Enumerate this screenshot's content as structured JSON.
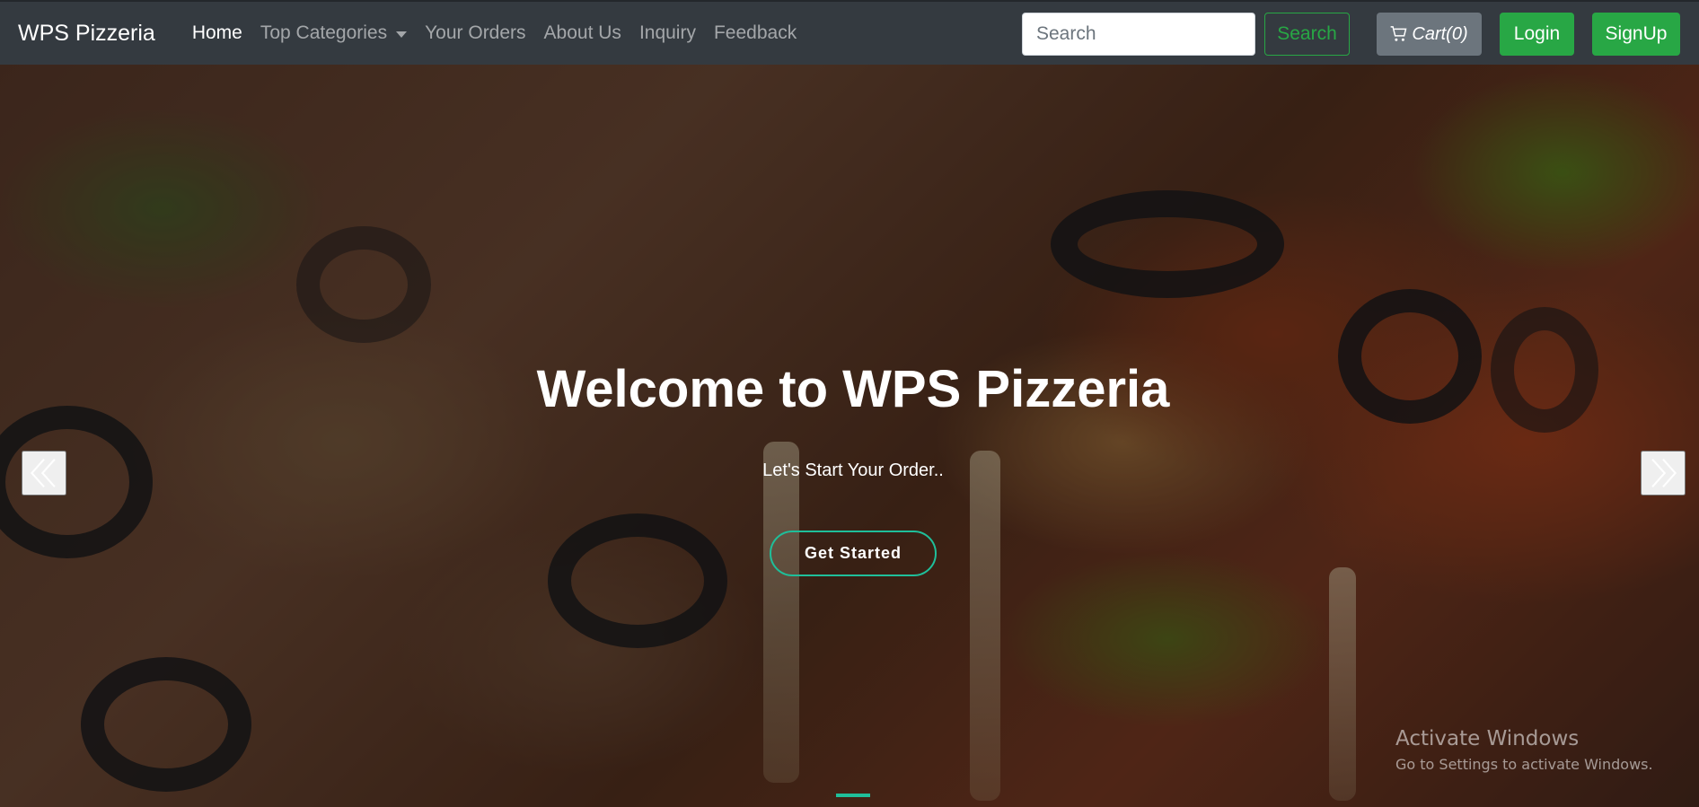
{
  "navbar": {
    "brand": "WPS Pizzeria",
    "links": [
      {
        "label": "Home",
        "active": true
      },
      {
        "label": "Top Categories",
        "dropdown": true
      },
      {
        "label": "Your Orders"
      },
      {
        "label": "About Us"
      },
      {
        "label": "Inquiry"
      },
      {
        "label": "Feedback"
      }
    ],
    "search": {
      "placeholder": "Search",
      "button_label": "Search"
    },
    "cart_label": "Cart(0)",
    "login_label": "Login",
    "signup_label": "SignUp"
  },
  "hero": {
    "title": "Welcome to WPS Pizzeria",
    "subtitle": "Let's Start Your Order..",
    "cta_label": "Get Started"
  },
  "watermark": {
    "title": "Activate Windows",
    "subtitle": "Go to Settings to activate Windows."
  },
  "colors": {
    "navbar_bg": "#343a40",
    "success": "#28a745",
    "secondary": "#6c757d",
    "accent_teal": "#1fbf9a"
  },
  "icons": [
    "cart-icon",
    "chevron-double-left-icon",
    "chevron-double-right-icon",
    "caret-down-icon"
  ]
}
